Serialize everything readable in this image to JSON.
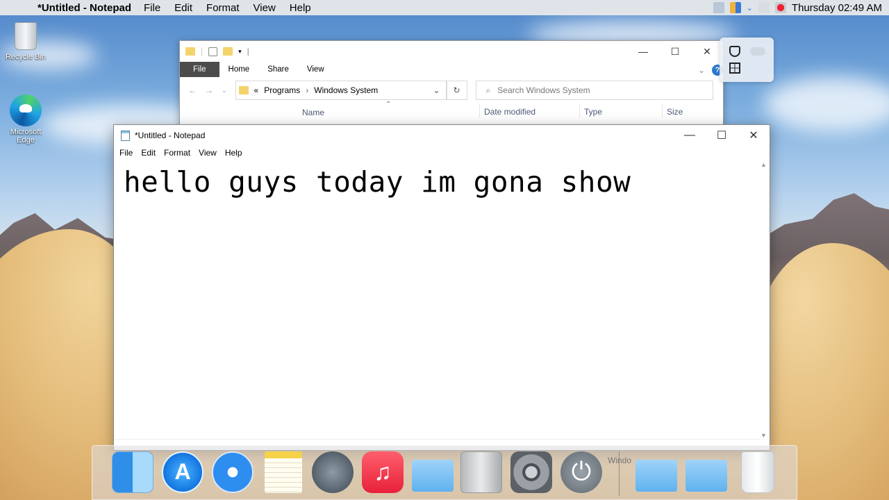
{
  "menubar": {
    "app_name": "*Untitled - Notepad",
    "menus": [
      "File",
      "Edit",
      "Format",
      "View",
      "Help"
    ],
    "clock": "Thursday 02:49 AM"
  },
  "desktop": {
    "icons": [
      {
        "label": "Recycle Bin"
      },
      {
        "label": "Microsoft Edge"
      }
    ]
  },
  "explorer": {
    "ribbon_tabs": [
      "File",
      "Home",
      "Share",
      "View"
    ],
    "breadcrumb": {
      "prefix": "«",
      "items": [
        "Programs",
        "Windows System"
      ],
      "separator": "›"
    },
    "search_placeholder": "Search Windows System",
    "columns": [
      "Name",
      "Date modified",
      "Type",
      "Size"
    ],
    "help_label": "?"
  },
  "notepad": {
    "title": "*Untitled - Notepad",
    "menus": [
      "File",
      "Edit",
      "Format",
      "View",
      "Help"
    ],
    "content": "hello guys today im gona show"
  },
  "dock": {
    "items": [
      "finder",
      "app-store",
      "safari",
      "notes",
      "launchpad",
      "music",
      "library-folder",
      "mac-pro",
      "system-preferences",
      "power",
      "windows-folder",
      "documents-folder",
      "trash"
    ],
    "ghost_label": "Windo"
  },
  "colors": {
    "ribbon_file_bg": "#4c4c4c",
    "help_blue": "#2b78d0"
  }
}
